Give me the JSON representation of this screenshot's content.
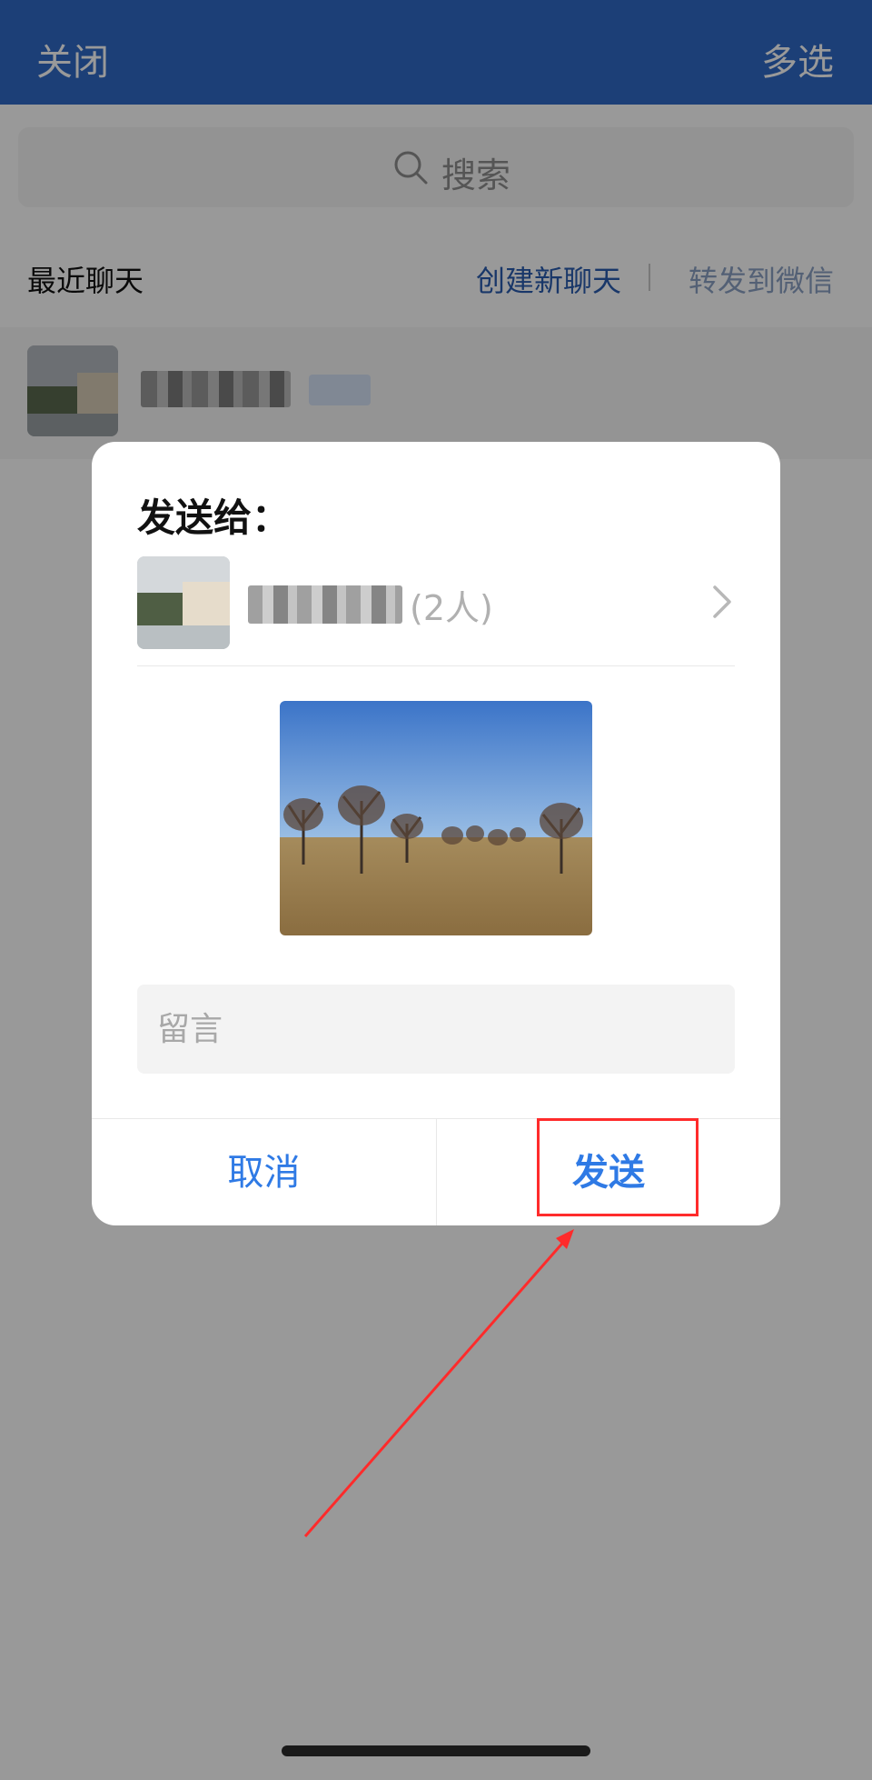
{
  "topbar": {
    "close_label": "关闭",
    "multi_select_label": "多选"
  },
  "search": {
    "placeholder": "搜索"
  },
  "section": {
    "title": "最近聊天",
    "create_chat": "创建新聊天",
    "forward_wechat": "转发到微信"
  },
  "modal": {
    "send_to": "发送给：",
    "recipient_tail": "(2人)",
    "note_placeholder": "留言",
    "cancel_label": "取消",
    "send_label": "发送"
  },
  "colors": {
    "topbar": "#2f69c6",
    "accent_blue": "#2f7ae5",
    "highlight_red": "#ff2b2b"
  },
  "icons": [
    "search-icon",
    "chevron-right-icon"
  ]
}
